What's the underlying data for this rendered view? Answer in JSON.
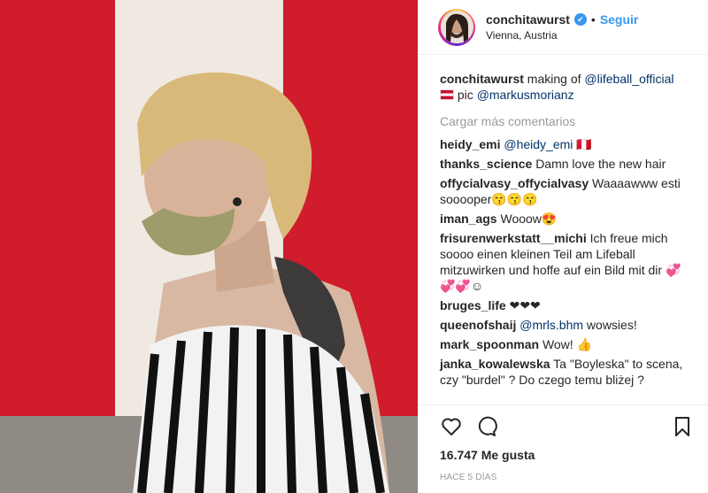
{
  "header": {
    "username": "conchitawurst",
    "verified_icon": "verified-badge-icon",
    "separator": "•",
    "follow_label": "Seguir",
    "location": "Vienna, Austria"
  },
  "caption": {
    "username": "conchitawurst",
    "text": " making of ",
    "mention1": "@lifeball_official",
    "flag_icon": "austria-flag-icon",
    "text2": " pic ",
    "mention2": "@markusmorianz"
  },
  "load_more": "Cargar más comentarios",
  "comments": [
    {
      "user": "heidy_emi",
      "mention": "@heidy_emi",
      "text": "",
      "emoji": "🇵🇪"
    },
    {
      "user": "thanks_science",
      "mention": "",
      "text": "Damn love the new hair",
      "emoji": ""
    },
    {
      "user": "offycialvasy_offycialvasy",
      "mention": "",
      "text": "Waaaawww esti sooooper",
      "emoji": "😙😙😙"
    },
    {
      "user": "iman_ags",
      "mention": "",
      "text": "Wooow",
      "emoji": "😍"
    },
    {
      "user": "frisurenwerkstatt__michi",
      "mention": "",
      "text": "Ich freue mich soooo einen kleinen Teil am Lifeball mitzuwirken und hoffe auf ein Bild mit dir",
      "emoji": "💞💞💞☺"
    },
    {
      "user": "bruges_life",
      "mention": "",
      "text": "",
      "emoji": "❤❤❤"
    },
    {
      "user": "queenofshaij",
      "mention": "@mrls.bhm",
      "text": " wowsies!",
      "emoji": ""
    },
    {
      "user": "mark_spoonman",
      "mention": "",
      "text": "Wow!",
      "emoji": "👍"
    },
    {
      "user": "janka_kowalewska",
      "mention": "",
      "text": "Ta \"Boyleska\" to scena, czy \"burdel\" ? Do czego temu bliżej ?",
      "emoji": ""
    }
  ],
  "actions": {
    "like_icon": "heart-icon",
    "comment_icon": "comment-icon",
    "save_icon": "bookmark-icon",
    "likes": "16.747 Me gusta",
    "time": "HACE 5 DÍAS"
  },
  "colors": {
    "accent": "#3897f0",
    "flag_red": "#c8102e",
    "text": "#262626",
    "muted": "#999999"
  }
}
